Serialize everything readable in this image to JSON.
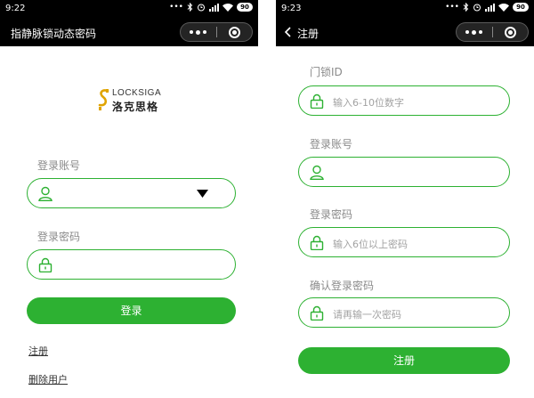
{
  "colors": {
    "accent": "#2db132",
    "bar": "#000000",
    "label": "#8a8a8a",
    "placeholder": "#a2a2a2"
  },
  "login_screen": {
    "status": {
      "time": "9:22",
      "battery": "90"
    },
    "title": "指静脉锁动态密码",
    "brand": {
      "name_en": "LOCKSIGA",
      "name_cn": "洛克思格"
    },
    "account": {
      "label": "登录账号",
      "icon": "user-icon",
      "placeholder": ""
    },
    "password": {
      "label": "登录密码",
      "icon": "lock-icon",
      "placeholder": ""
    },
    "login_label": "登录",
    "links": {
      "register": "注册",
      "delete_user": "删除用户"
    }
  },
  "register_screen": {
    "status": {
      "time": "9:23",
      "battery": "90"
    },
    "title": "注册",
    "lock_id": {
      "label": "门锁ID",
      "icon": "lock-icon",
      "placeholder": "输入6-10位数字"
    },
    "account": {
      "label": "登录账号",
      "icon": "user-icon",
      "placeholder": ""
    },
    "password": {
      "label": "登录密码",
      "icon": "lock-icon",
      "placeholder": "输入6位以上密码"
    },
    "confirm_password": {
      "label": "确认登录密码",
      "icon": "lock-icon",
      "placeholder": "请再输一次密码"
    },
    "register_label": "注册"
  }
}
